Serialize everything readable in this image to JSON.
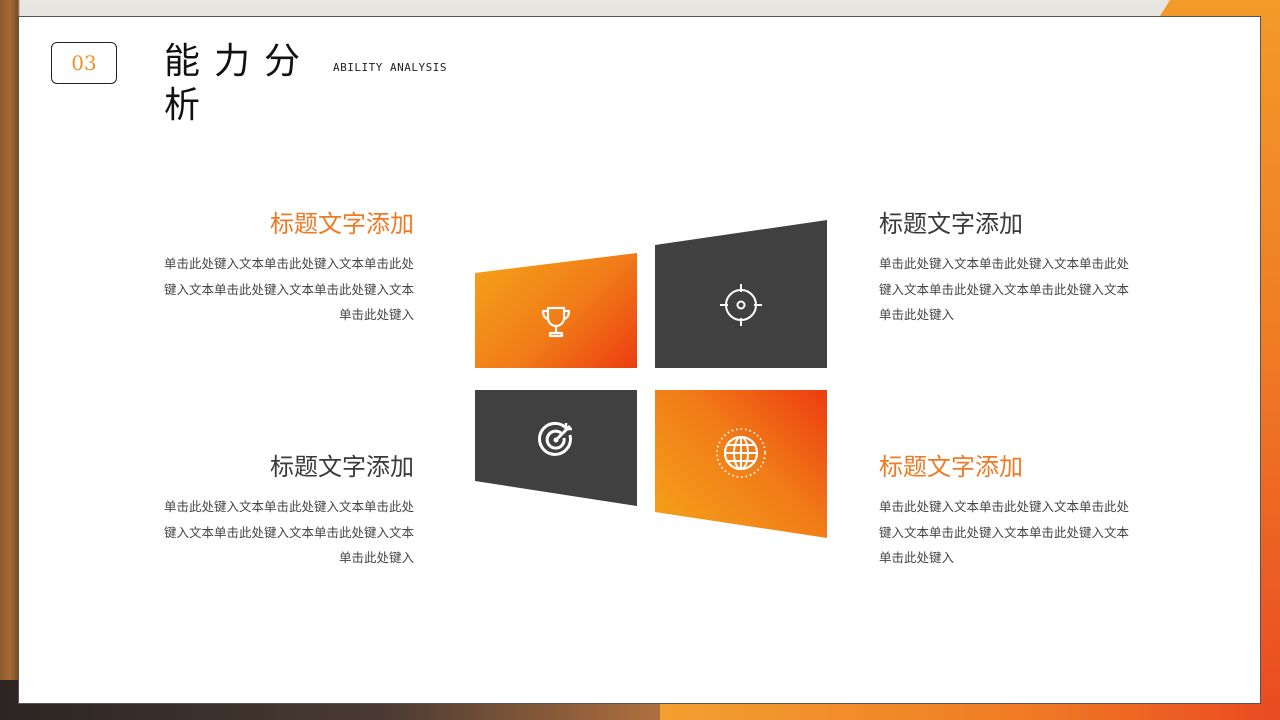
{
  "header": {
    "number": "03",
    "title": "能力分析",
    "subtitle": "ABILITY ANALYSIS"
  },
  "blocks": [
    {
      "title": "标题文字添加",
      "text": "单击此处键入文本单击此处键入文本单击此处键入文本单击此处键入文本单击此处键入文本单击此处键入",
      "color": "#f07a24"
    },
    {
      "title": "标题文字添加",
      "text": "单击此处键入文本单击此处键入文本单击此处键入文本单击此处键入文本单击此处键入文本单击此处键入",
      "color": "#3a3a3a"
    },
    {
      "title": "标题文字添加",
      "text": "单击此处键入文本单击此处键入文本单击此处键入文本单击此处键入文本单击此处键入文本单击此处键入",
      "color": "#3a3a3a"
    },
    {
      "title": "标题文字添加",
      "text": "单击此处键入文本单击此处键入文本单击此处键入文本单击此处键入文本单击此处键入文本单击此处键入",
      "color": "#f07a24"
    }
  ],
  "tiles": [
    {
      "icon": "trophy-icon",
      "style": "orange-gradient"
    },
    {
      "icon": "crosshair-icon",
      "style": "dark"
    },
    {
      "icon": "target-dart-icon",
      "style": "dark"
    },
    {
      "icon": "globe-icon",
      "style": "orange-gradient"
    }
  ],
  "colors": {
    "accent": "#f07a24",
    "accent_light": "#f5a31a",
    "accent_red": "#ec3c10",
    "dark_tile": "#404040",
    "number": "#f0922a"
  }
}
